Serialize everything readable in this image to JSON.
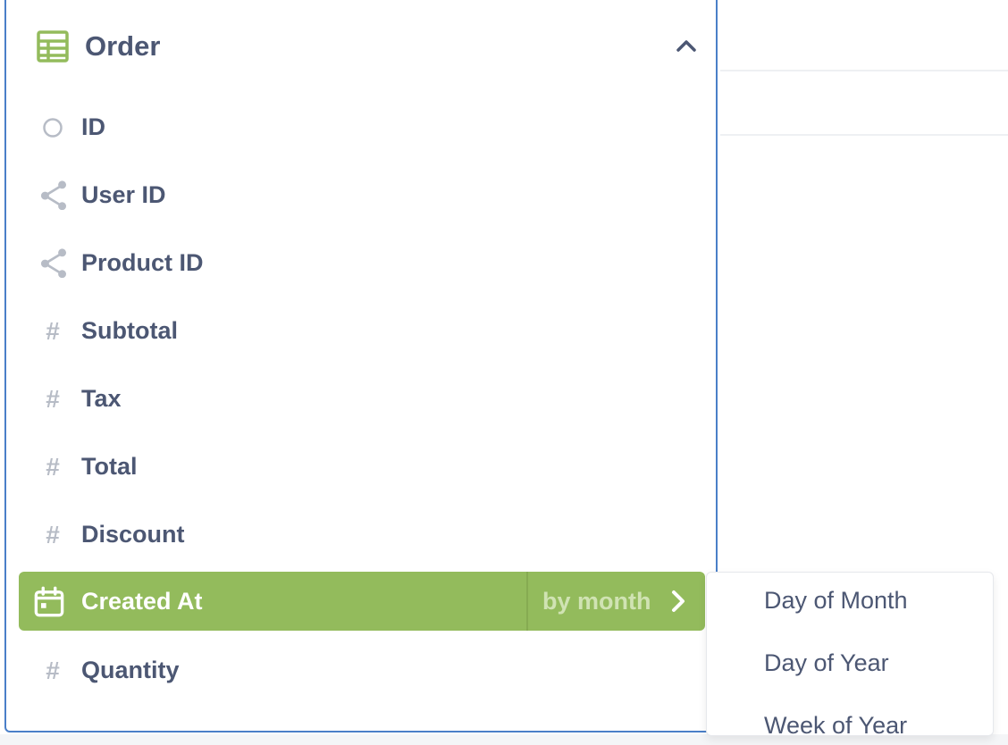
{
  "table": {
    "title": "Order",
    "icon": "table-icon"
  },
  "fields": [
    {
      "label": "ID",
      "icon": "circle-icon"
    },
    {
      "label": "User ID",
      "icon": "connections-icon"
    },
    {
      "label": "Product ID",
      "icon": "connections-icon"
    },
    {
      "label": "Subtotal",
      "icon": "hash-icon",
      "glyph": "#"
    },
    {
      "label": "Tax",
      "icon": "hash-icon",
      "glyph": "#"
    },
    {
      "label": "Total",
      "icon": "hash-icon",
      "glyph": "#"
    },
    {
      "label": "Discount",
      "icon": "hash-icon",
      "glyph": "#"
    },
    {
      "label": "Created At",
      "icon": "calendar-icon",
      "bucket": "by month",
      "selected": true
    },
    {
      "label": "Quantity",
      "icon": "hash-icon",
      "glyph": "#"
    }
  ],
  "submenu": {
    "items": [
      "Day of Month",
      "Day of Year",
      "Week of Year"
    ]
  },
  "colors": {
    "accent": "#93bb5c",
    "text": "#4c5773",
    "icon_muted": "#b7bcc6",
    "panel_border": "#4a7fc8"
  }
}
